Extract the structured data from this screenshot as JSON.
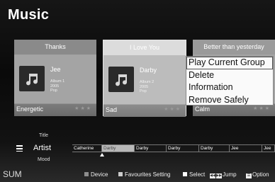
{
  "header": {
    "title": "Music"
  },
  "cards": [
    {
      "title": "Thanks",
      "artist": "Jee",
      "album": "Album 1",
      "year": "2005",
      "genre": "Pop",
      "mood": "Energetic",
      "stars": "★★★"
    },
    {
      "title": "I Love You",
      "artist": "Darby",
      "album": "Album 2",
      "year": "2005",
      "genre": "Pop",
      "mood": "Sad",
      "stars": "★★★"
    },
    {
      "title": "Better than yesterday",
      "mood": "Calm",
      "stars": "★★★"
    }
  ],
  "context_menu": {
    "items": [
      "Play Current Group",
      "Delete",
      "Information",
      "Remove Safely"
    ],
    "selected_index": 0
  },
  "sort": {
    "above": "Title",
    "current": "Artist",
    "below": "Mood"
  },
  "artist_strip": [
    "Catherine",
    "Darby",
    "Darby",
    "Darby",
    "Darby",
    "Darby",
    "Jee",
    "Jee"
  ],
  "bottom": {
    "source": "SUM",
    "device": "Device",
    "favourites": "Favourites Setting",
    "select": "Select",
    "jump": "Jump",
    "option": "Option"
  },
  "colors": {
    "device_key": "#8e8e8e",
    "favourites_key": "#cccccc",
    "select_key": "#ffffff"
  }
}
